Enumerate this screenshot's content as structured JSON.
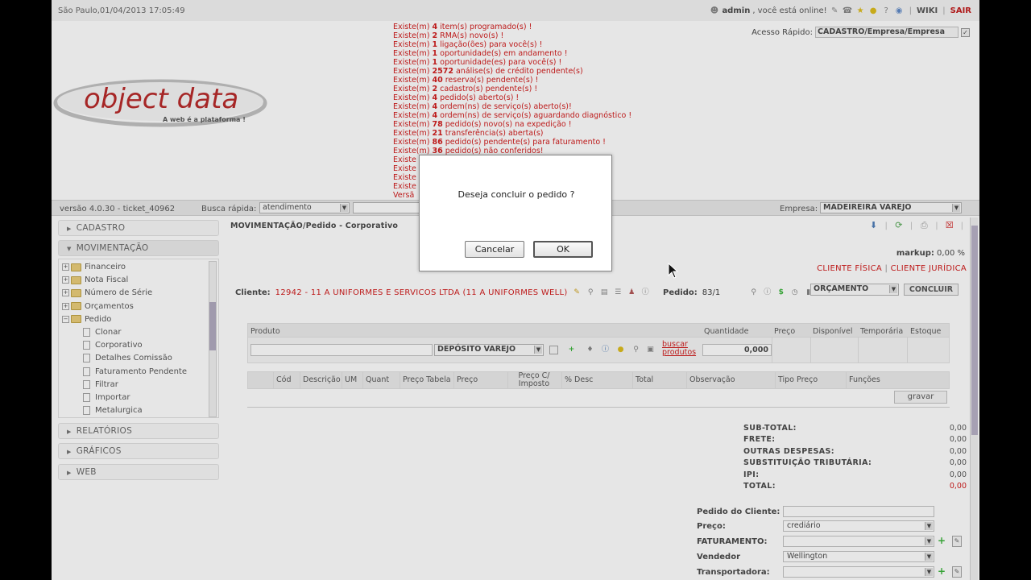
{
  "topbar": {
    "datetime": "São Paulo,01/04/2013 17:05:49",
    "user_text": "admin",
    "online_text": ", você está online!",
    "wiki": "WIKI",
    "sair": "SAIR",
    "sep": "|"
  },
  "logo": {
    "name": "object data",
    "tagline": "A web é a plataforma !"
  },
  "alerts": [
    {
      "pre": "Existe(m) ",
      "num": "4",
      "post": " item(s) programado(s) !"
    },
    {
      "pre": "Existe(m) ",
      "num": "2",
      "post": " RMA(s) novo(s) !"
    },
    {
      "pre": "Existe(m) ",
      "num": "1",
      "post": " ligação(ões) para você(s) !"
    },
    {
      "pre": "Existe(m) ",
      "num": "1",
      "post": " oportunidade(s) em andamento !"
    },
    {
      "pre": "Existe(m) ",
      "num": "1",
      "post": " oportunidade(es) para você(s) !"
    },
    {
      "pre": "Existe(m) ",
      "num": "2572",
      "post": " análise(s) de crédito pendente(s)"
    },
    {
      "pre": "Existe(m) ",
      "num": "40",
      "post": " reserva(s) pendente(s) !"
    },
    {
      "pre": "Existe(m) ",
      "num": "2",
      "post": " cadastro(s) pendente(s) !"
    },
    {
      "pre": "Existe(m) ",
      "num": "4",
      "post": " pedido(s) aberto(s) !"
    },
    {
      "pre": "Existe(m) ",
      "num": "4",
      "post": " ordem(ns) de serviço(s) aberto(s)!"
    },
    {
      "pre": "Existe(m) ",
      "num": "4",
      "post": " ordem(ns) de serviço(s) aguardando diagnóstico !"
    },
    {
      "pre": "Existe(m) ",
      "num": "78",
      "post": " pedido(s) novo(s) na expedição !"
    },
    {
      "pre": "Existe(m) ",
      "num": "21",
      "post": " transferência(s) aberta(s)"
    },
    {
      "pre": "Existe(m) ",
      "num": "86",
      "post": " pedido(s) pendente(s) para faturamento !"
    },
    {
      "pre": "Existe(m) ",
      "num": "36",
      "post": " pedido(s) não conferidos!"
    },
    {
      "pre": "Existe",
      "num": "",
      "post": ""
    },
    {
      "pre": "Existe",
      "num": "",
      "post": ""
    },
    {
      "pre": "Existe",
      "num": "",
      "post": ""
    },
    {
      "pre": "Existe",
      "num": "",
      "post": ""
    },
    {
      "pre": "Versã",
      "num": "",
      "post": ""
    }
  ],
  "quick_access": {
    "label": "Acesso Rápido:",
    "value": "CADASTRO/Empresa/Empresa"
  },
  "verbar": {
    "version": "versão 4.0.30 - ticket_40962",
    "busca_label": "Busca rápida:",
    "busca_value": "atendimento",
    "empresa_label": "Empresa:",
    "empresa_value": "MADEIREIRA VAREJO"
  },
  "sidebar": {
    "cadastro": "CADASTRO",
    "movimentacao": "MOVIMENTAÇÃO",
    "relatorios": "RELATÓRIOS",
    "graficos": "GRÁFICOS",
    "web": "WEB",
    "tree": {
      "folders": [
        "Financeiro",
        "Nota Fiscal",
        "Número de Série",
        "Orçamentos",
        "Pedido"
      ],
      "pedido_items": [
        "Clonar",
        "Corporativo",
        "Detalhes Comissão",
        "Faturamento Pendente",
        "Filtrar",
        "Importar",
        "Metalurgica"
      ]
    }
  },
  "main": {
    "breadcrumb": "MOVIMENTAÇÃO/Pedido - Corporativo",
    "markup_label": "markup:",
    "markup_value": "0,00 %",
    "cliente_fisica": "CLIENTE FÍSICA",
    "cliente_juridica": "CLIENTE JURÍDICA",
    "cliente_label": "Cliente:",
    "cliente_value": "12942 - 11 A UNIFORMES E SERVICOS LTDA (11 A UNIFORMES WELL)",
    "pedido_label": "Pedido:",
    "pedido_value": "83/1",
    "orcamento": "ORÇAMENTO",
    "concluir": "CONCLUIR"
  },
  "product_table": {
    "headers": {
      "produto": "Produto",
      "quantidade": "Quantidade",
      "preco": "Preço",
      "disponivel": "Disponível",
      "temporaria": "Temporária",
      "estoque": "Estoque"
    },
    "deposito": "DEPÓSITO VAREJO",
    "buscar": "buscar produtos",
    "quantidade": "0,000"
  },
  "items_table": {
    "headers": [
      "Cód",
      "Descrição",
      "UM",
      "Quant",
      "Preço Tabela",
      "Preço",
      "Preço C/ Imposto",
      "% Desc",
      "Total",
      "Observação",
      "Tipo Preço",
      "Funções"
    ],
    "gravar": "gravar"
  },
  "totals": [
    {
      "label": "SUB-TOTAL:",
      "value": "0,00"
    },
    {
      "label": "FRETE:",
      "value": "0,00"
    },
    {
      "label": "OUTRAS DESPESAS:",
      "value": "0,00"
    },
    {
      "label": "SUBSTITUIÇÃO TRIBUTÁRIA:",
      "value": "0,00"
    },
    {
      "label": "IPI:",
      "value": "0,00"
    },
    {
      "label": "TOTAL:",
      "value": "0,00"
    }
  ],
  "form": {
    "pedido_cliente_label": "Pedido do Cliente:",
    "pedido_cliente_value": "",
    "preco_label": "Preço:",
    "preco_value": "crediário",
    "faturamento_label": "FATURAMENTO:",
    "faturamento_value": "",
    "vendedor_label": "Vendedor",
    "vendedor_value": "Wellington",
    "transportadora_label": "Transportadora:",
    "transportadora_value": ""
  },
  "dialog": {
    "message": "Deseja concluir o pedido ?",
    "cancel": "Cancelar",
    "ok": "OK"
  },
  "colors": {
    "alert_red": "#cc0000",
    "logo_red": "#b01010",
    "accent_green": "#22aa22"
  }
}
